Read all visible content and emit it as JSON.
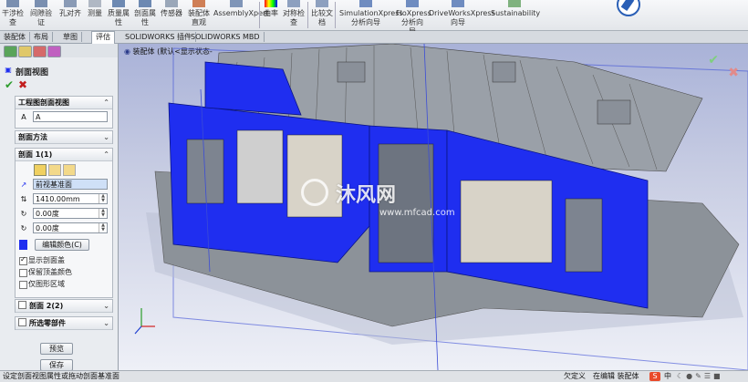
{
  "toolbar": {
    "buttons": [
      {
        "label": "干涉检\n查",
        "icon": "interference-icon"
      },
      {
        "label": "间隙验\n证",
        "icon": "clearance-icon"
      },
      {
        "label": "孔对齐",
        "icon": "hole-align-icon"
      },
      {
        "label": "测量",
        "icon": "measure-icon"
      },
      {
        "label": "质量属\n性",
        "icon": "mass-props-icon"
      },
      {
        "label": "剖面属\n性",
        "icon": "section-props-icon"
      },
      {
        "label": "传感器",
        "icon": "sensor-icon"
      },
      {
        "label": "装配体\n直观",
        "icon": "asm-visual-icon"
      },
      {
        "label": "AssemblyXpert",
        "icon": "asmxpert-icon"
      },
      {
        "label": "曲率",
        "icon": "curvature-icon"
      },
      {
        "label": "对称检\n查",
        "icon": "symmetry-icon"
      },
      {
        "label": "比较文\n档",
        "icon": "compare-icon"
      },
      {
        "label": "SimulationXpress\n分析向导",
        "icon": "simxpress-icon"
      },
      {
        "label": "FloXpress\n分析向\n导",
        "icon": "floxpress-icon"
      },
      {
        "label": "DriveWorksXpress\n向导",
        "icon": "driveworks-icon"
      },
      {
        "label": "Sustainability",
        "icon": "sustainability-icon"
      }
    ]
  },
  "tabs": [
    "装配体",
    "布局",
    "草图",
    "评估",
    "SOLIDWORKS 插件",
    "SOLIDWORKS MBD"
  ],
  "active_tab": "评估",
  "panel": {
    "title": "剖面视图",
    "sections": {
      "drawing_section": "工程图剖面视图",
      "label_value": "A",
      "method": "剖面方法",
      "section1": "剖面 1(1)",
      "plane": "前视基准面",
      "offset": "1410.00mm",
      "angle1": "0.00度",
      "angle2": "0.00度",
      "edit_color": "编辑颜色(C)",
      "cb_show_cap": "显示剖面盖",
      "cb_keep_top": "保留顶盖颜色",
      "cb_graphic_only": "仅图形区域",
      "section2": "剖面 2(2)",
      "selected_parts": "所选零部件",
      "preview": "预览",
      "save": "保存"
    }
  },
  "viewport": {
    "tree_label": "装配体 (默认<显示状态-",
    "watermark": "沐风网",
    "watermark_url": "www.mfcad.com"
  },
  "status": {
    "message": "设定剖面视图属性或拖动剖面基准面",
    "undefined": "欠定义",
    "editing": "在编辑 装配体",
    "tray": "中"
  },
  "colors": {
    "section_blue": "#1f2ef0",
    "model_gray": "#8c9299"
  }
}
